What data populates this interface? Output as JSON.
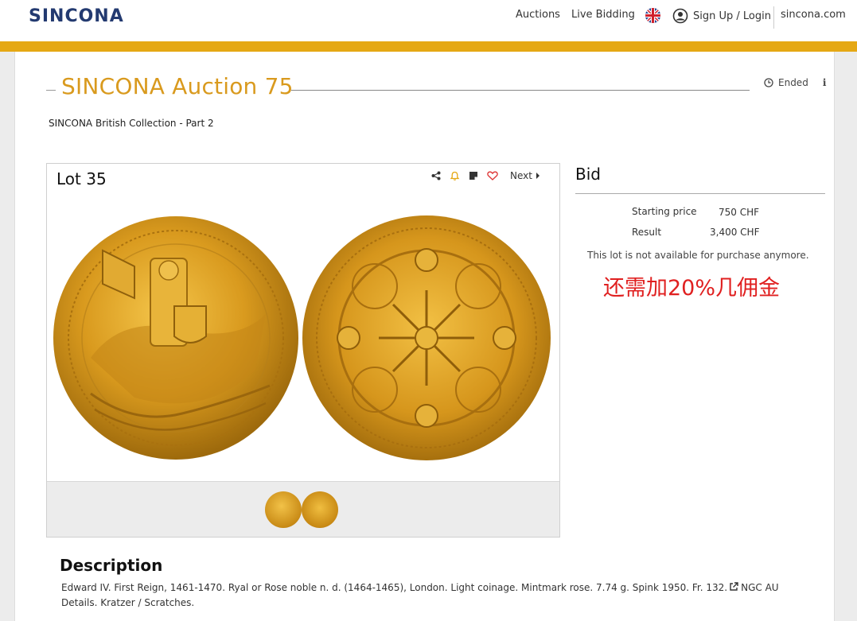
{
  "header": {
    "logo": "SINCONA",
    "nav": {
      "auctions": "Auctions",
      "live_bidding": "Live Bidding",
      "login": "Sign Up / Login",
      "site": "sincona.com"
    },
    "language_icon": "uk-flag-icon",
    "user_icon": "user-circle-icon"
  },
  "auction": {
    "title": "SINCONA Auction 75",
    "subtitle": "SINCONA British Collection - Part 2",
    "status": "Ended",
    "status_icon": "clock-icon",
    "info_icon": "info-icon"
  },
  "lot": {
    "title": "Lot 35",
    "tools": {
      "share_icon": "share-icon",
      "alert_icon": "bell-icon",
      "note_icon": "note-icon",
      "watch_icon": "heart-icon",
      "next_label": "Next"
    },
    "images": [
      "coin-obverse",
      "coin-reverse"
    ]
  },
  "bid": {
    "heading": "Bid",
    "starting_price_label": "Starting price",
    "starting_price_value": "750 CHF",
    "result_label": "Result",
    "result_value": "3,400 CHF",
    "availability": "This lot is not available for purchase anymore.",
    "note": "还需加20%几佣金"
  },
  "description": {
    "heading": "Description",
    "text_before_link": "Edward IV. First Reign, 1461-1470. Ryal or Rose noble n. d. (1464-1465), London. Light coinage. Mintmark rose. 7.74 g. Spink 1950. Fr. 132.",
    "link_text": "NGC AU",
    "text_after_link": "Details. Kratzer / Scratches."
  },
  "colors": {
    "brand_navy": "#233a70",
    "accent_gold": "#e5a814",
    "title_gold": "#d99a1e",
    "note_red": "#e02020"
  }
}
